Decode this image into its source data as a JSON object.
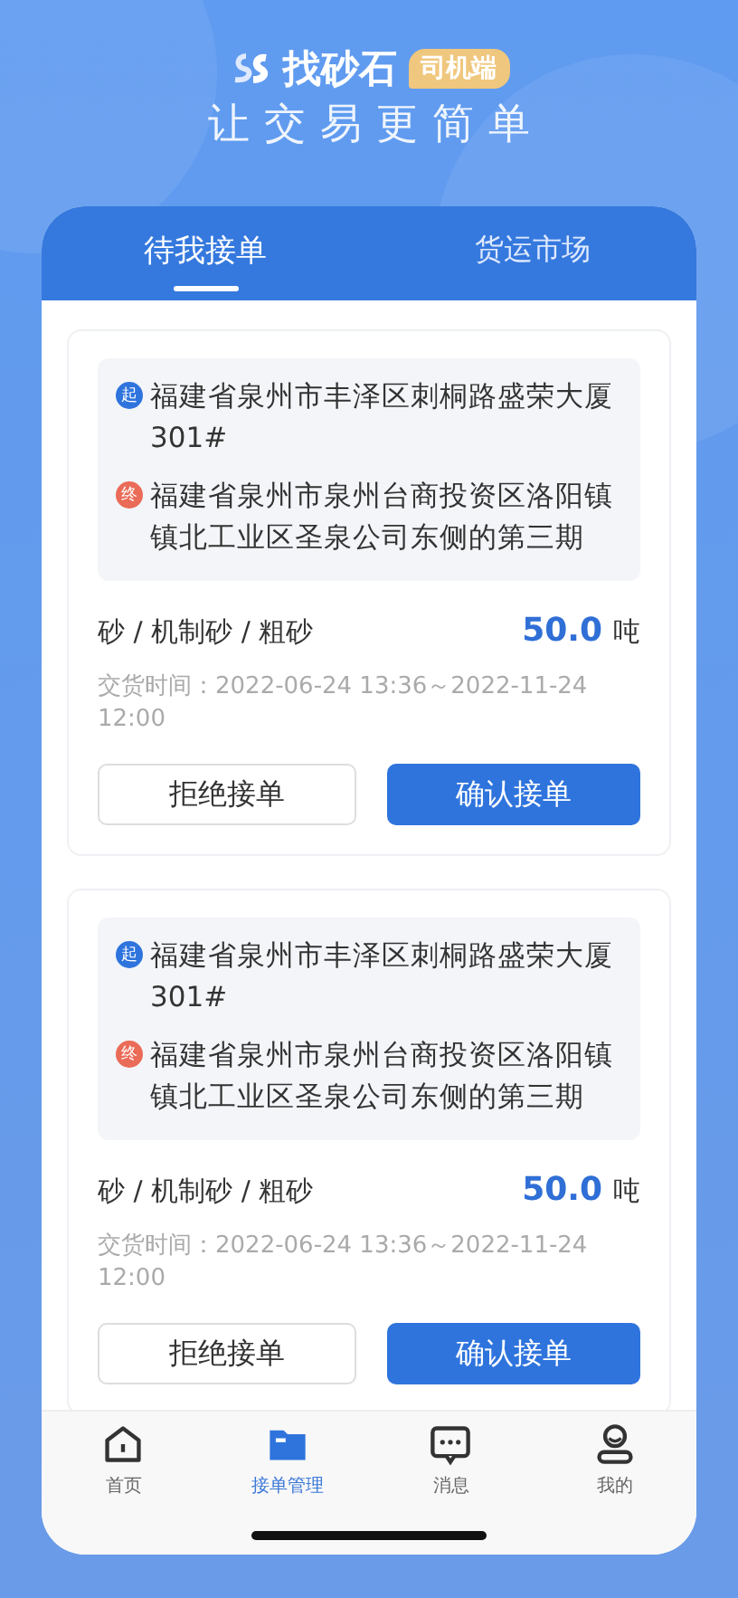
{
  "header": {
    "brand": "找砂石",
    "badge": "司机端",
    "slogan": "让交易更简单"
  },
  "tabs": [
    {
      "label": "待我接单",
      "selected": true
    },
    {
      "label": "货运市场",
      "selected": false
    }
  ],
  "orders": [
    {
      "origin_mark": "起",
      "origin": "福建省泉州市丰泽区刺桐路盛荣大厦301#",
      "dest_mark": "终",
      "destination": "福建省泉州市泉州台商投资区洛阳镇镇北工业区圣泉公司东侧的第三期",
      "material": "砂 / 机制砂 / 粗砂",
      "amount": "50.0",
      "unit": "吨",
      "delivery": "交货时间：2022-06-24 13:36～2022-11-24 12:00",
      "reject": "拒绝接单",
      "accept": "确认接单"
    },
    {
      "origin_mark": "起",
      "origin": "福建省泉州市丰泽区刺桐路盛荣大厦301#",
      "dest_mark": "终",
      "destination": "福建省泉州市泉州台商投资区洛阳镇镇北工业区圣泉公司东侧的第三期",
      "material": "砂 / 机制砂 / 粗砂",
      "amount": "50.0",
      "unit": "吨",
      "delivery": "交货时间：2022-06-24 13:36～2022-11-24 12:00",
      "reject": "拒绝接单",
      "accept": "确认接单"
    }
  ],
  "nav": [
    {
      "kind": "home",
      "label": "首页",
      "selected": false
    },
    {
      "kind": "orders",
      "label": "接单管理",
      "selected": true
    },
    {
      "kind": "messages",
      "label": "消息",
      "selected": false
    },
    {
      "kind": "profile",
      "label": "我的",
      "selected": false
    }
  ]
}
